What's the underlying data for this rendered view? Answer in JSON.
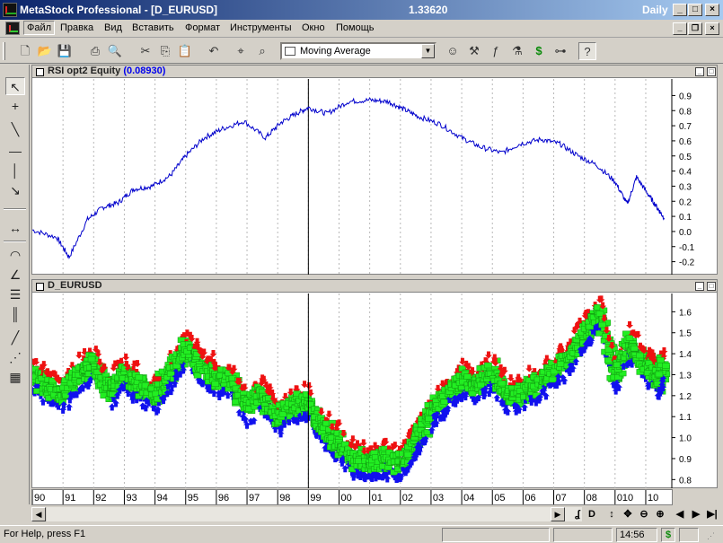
{
  "window": {
    "title": "MetaStock Professional - [D_EURUSD]",
    "price": "1.33620",
    "periodicity": "Daily"
  },
  "menu": [
    "Файл",
    "Правка",
    "Вид",
    "Вставить",
    "Формат",
    "Инструменты",
    "Окно",
    "Помощь"
  ],
  "toolbar": {
    "indicator_selected": "Moving Average"
  },
  "pane1": {
    "title": "RSI opt2 Equity",
    "value": "(0.08930)",
    "axis_ticks": [
      "0.9",
      "0.8",
      "0.7",
      "0.6",
      "0.5",
      "0.4",
      "0.3",
      "0.2",
      "0.1",
      "0.0",
      "-0.1",
      "-0.2"
    ]
  },
  "pane2": {
    "title": "D_EURUSD",
    "axis_ticks": [
      "1.6",
      "1.5",
      "1.4",
      "1.3",
      "1.2",
      "1.1",
      "1.0",
      "0.9",
      "0.8"
    ]
  },
  "date_axis": [
    "90",
    "91",
    "92",
    "93",
    "94",
    "95",
    "96",
    "97",
    "98",
    "99",
    "00",
    "01",
    "02",
    "03",
    "04",
    "05",
    "06",
    "07",
    "08",
    "010",
    "10"
  ],
  "status": {
    "help": "For Help, press F1",
    "time": "14:56"
  },
  "chart_data": [
    {
      "type": "line",
      "title": "RSI opt2 Equity",
      "x_unit": "year",
      "ylim": [
        -0.25,
        0.95
      ],
      "series": [
        {
          "name": "RSI opt2 Equity",
          "color": "#0000cc",
          "x": [
            1990.0,
            1990.8,
            1991.2,
            1991.8,
            1992.3,
            1992.8,
            1993.3,
            1993.9,
            1994.5,
            1995.0,
            1995.6,
            1996.2,
            1996.9,
            1997.6,
            1998.1,
            1998.6,
            1999.0,
            1999.6,
            2000.3,
            2001.0,
            2001.6,
            2002.1,
            2002.6,
            2003.3,
            2004.0,
            2004.6,
            2005.3,
            2005.9,
            2006.6,
            2007.2,
            2007.8,
            2008.4,
            2009.0,
            2009.4,
            2009.7,
            2010.1,
            2010.4,
            2010.6
          ],
          "values": [
            0.01,
            -0.04,
            -0.17,
            0.08,
            0.16,
            0.19,
            0.28,
            0.3,
            0.37,
            0.5,
            0.62,
            0.68,
            0.73,
            0.62,
            0.72,
            0.78,
            0.82,
            0.78,
            0.86,
            0.87,
            0.86,
            0.81,
            0.76,
            0.71,
            0.62,
            0.56,
            0.52,
            0.58,
            0.61,
            0.58,
            0.5,
            0.44,
            0.33,
            0.18,
            0.36,
            0.24,
            0.15,
            0.09
          ]
        }
      ],
      "vertical_marker_x": 1999.0,
      "grid": "dotted vertical year lines"
    },
    {
      "type": "line",
      "title": "D_EURUSD",
      "x_unit": "year",
      "ylim": [
        0.78,
        1.67
      ],
      "series": [
        {
          "name": "D_EURUSD",
          "color": "#555555",
          "x": [
            1990.0,
            1990.5,
            1991.0,
            1991.5,
            1992.0,
            1992.5,
            1993.0,
            1993.5,
            1994.0,
            1994.5,
            1995.0,
            1995.5,
            1996.0,
            1996.5,
            1997.0,
            1997.5,
            1998.0,
            1998.5,
            1999.0,
            1999.5,
            2000.0,
            2000.5,
            2001.0,
            2001.5,
            2002.0,
            2002.5,
            2003.0,
            2003.5,
            2004.0,
            2004.5,
            2005.0,
            2005.5,
            2006.0,
            2006.5,
            2007.0,
            2007.5,
            2008.0,
            2008.5,
            2009.0,
            2009.5,
            2010.0,
            2010.4,
            2010.6
          ],
          "values": [
            1.3,
            1.25,
            1.2,
            1.3,
            1.35,
            1.23,
            1.3,
            1.25,
            1.2,
            1.3,
            1.42,
            1.35,
            1.29,
            1.27,
            1.15,
            1.2,
            1.1,
            1.15,
            1.17,
            1.05,
            0.97,
            0.9,
            0.88,
            0.9,
            0.88,
            0.98,
            1.12,
            1.2,
            1.28,
            1.25,
            1.32,
            1.2,
            1.22,
            1.25,
            1.32,
            1.38,
            1.5,
            1.6,
            1.3,
            1.45,
            1.35,
            1.27,
            1.34
          ]
        }
      ],
      "annotations": "green signal labels with red down-arrows (sell) above price and blue up-arrows (buy) below price",
      "vertical_marker_x": 1999.0
    }
  ]
}
